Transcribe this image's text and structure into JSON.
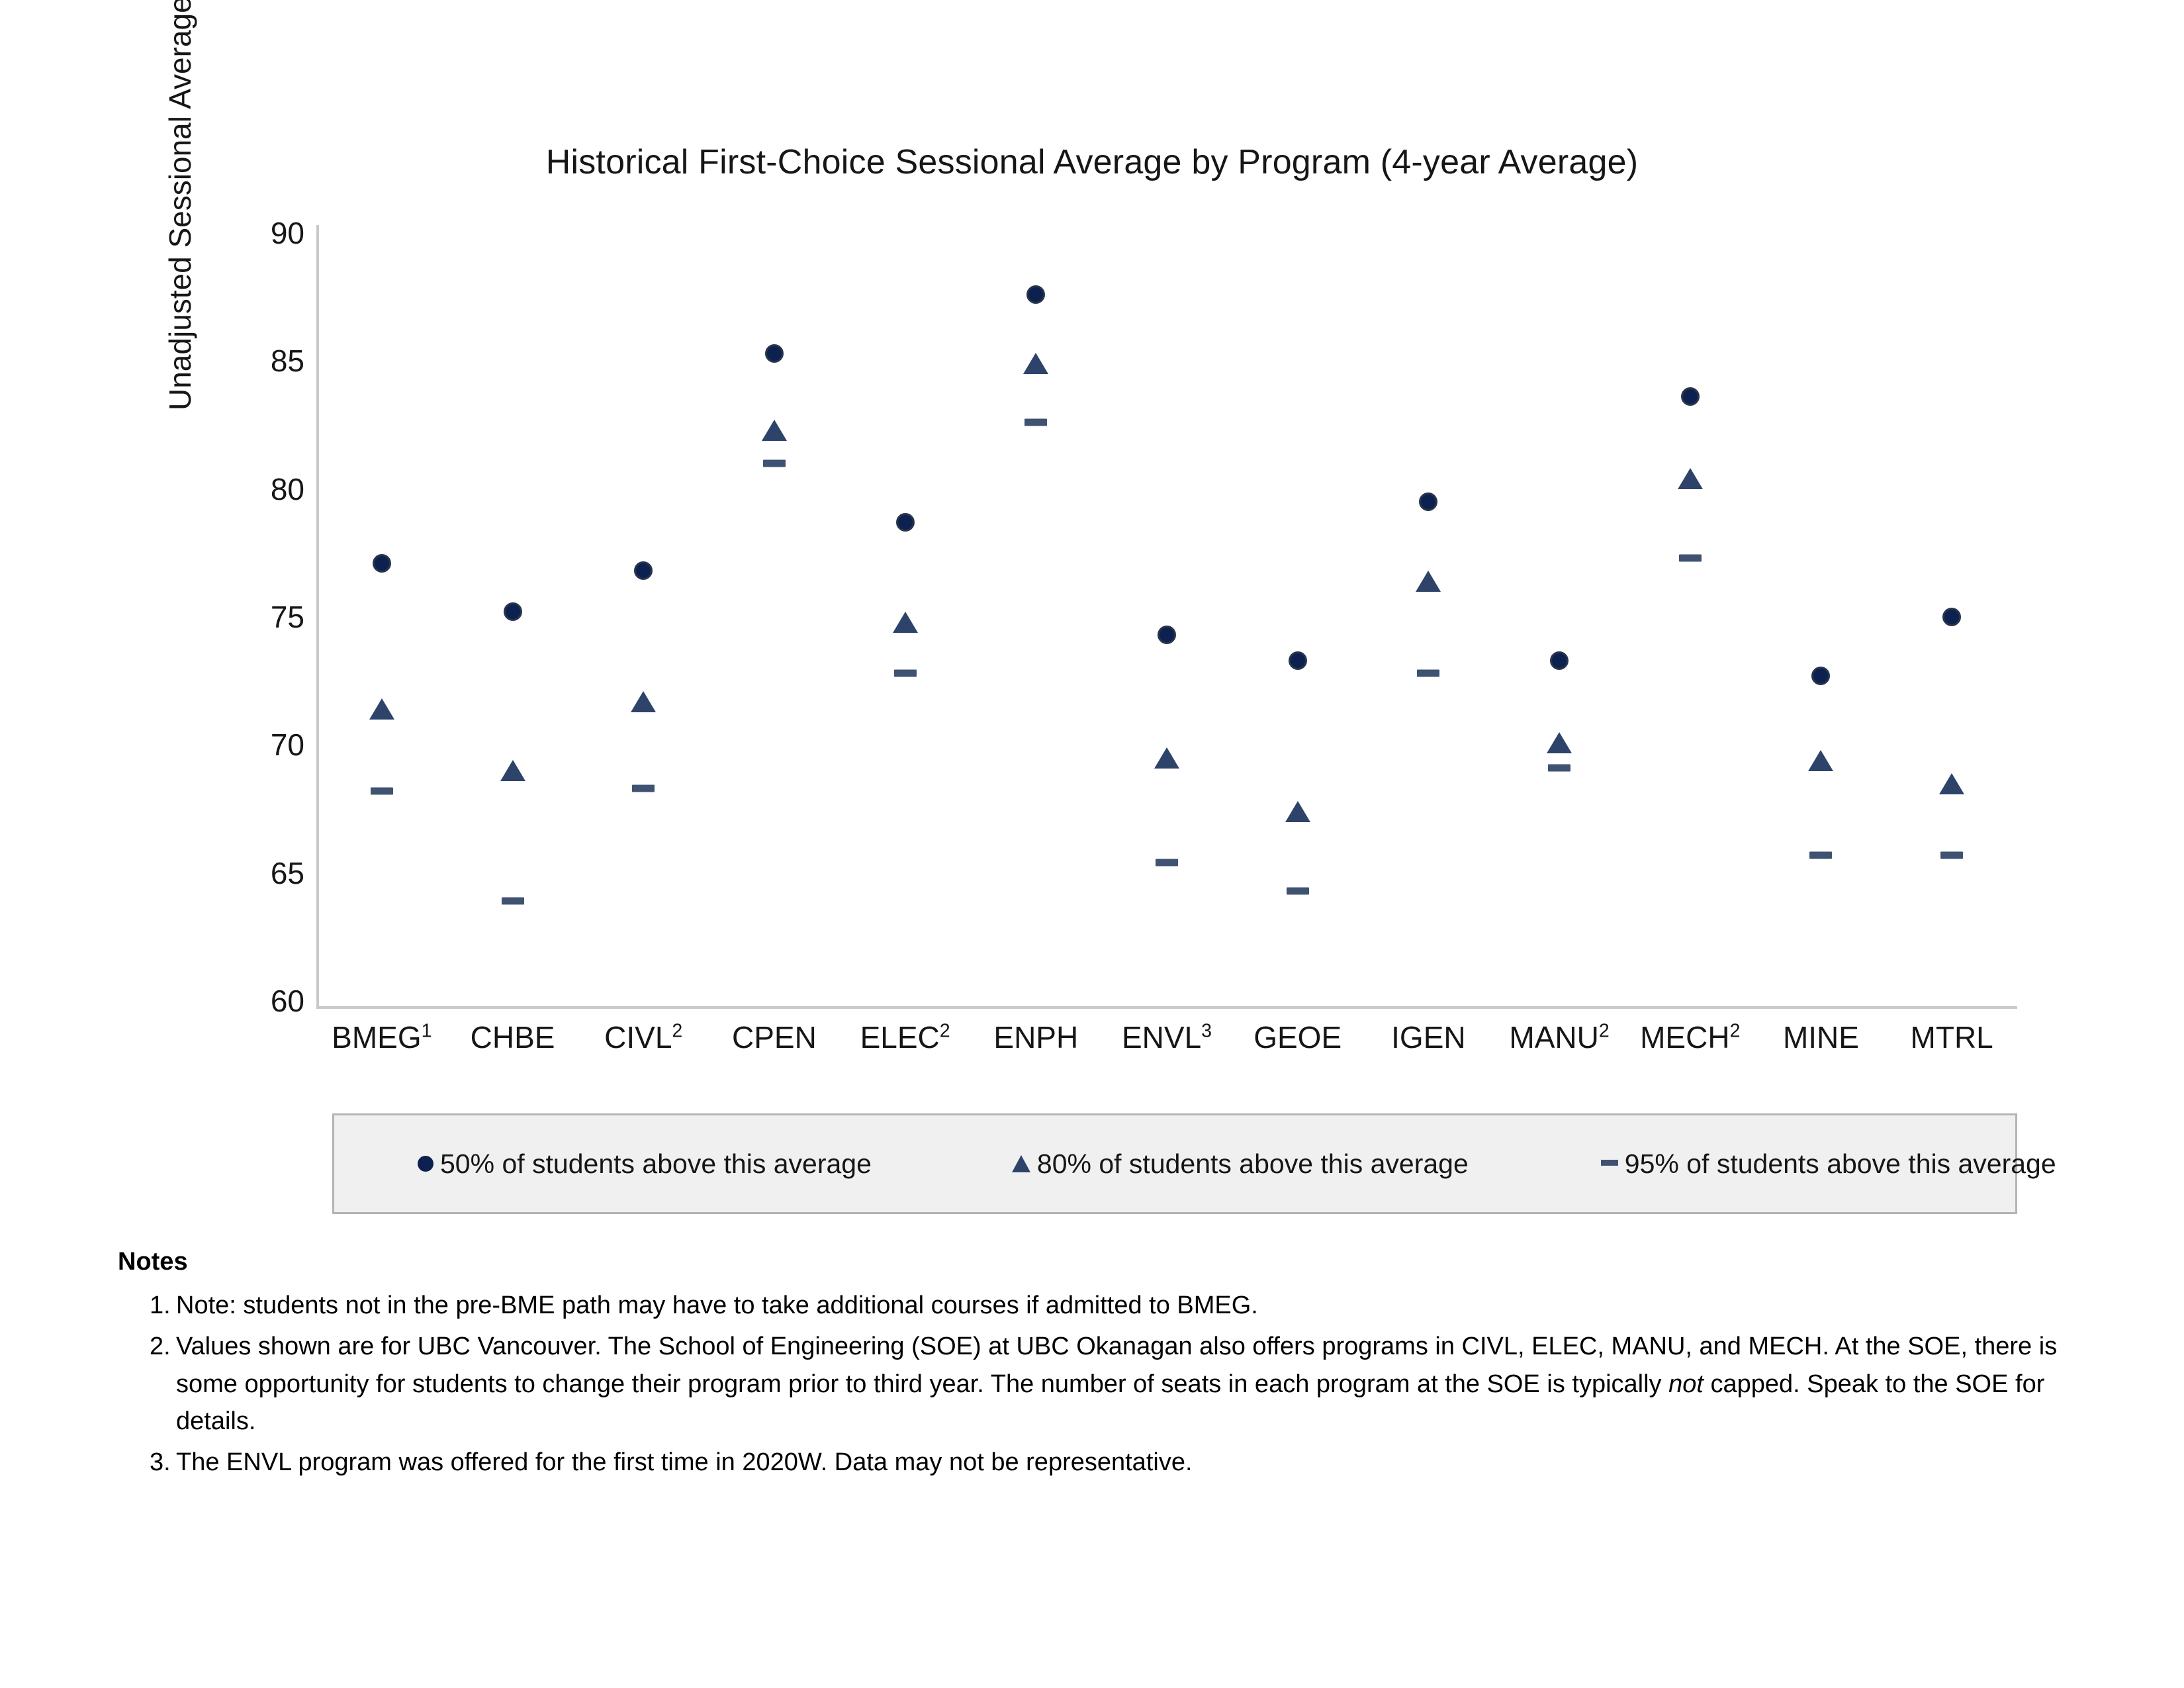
{
  "chart_data": {
    "type": "scatter",
    "title": "Historical First-Choice Sessional Average by Program (4-year Average)",
    "xlabel": "",
    "ylabel": "Unadjusted Sessional Average",
    "ylim": [
      60,
      90
    ],
    "ytick_labels": [
      "90",
      "85",
      "80",
      "75",
      "70",
      "65",
      "60"
    ],
    "yticks": [
      90,
      85,
      80,
      75,
      70,
      65,
      60
    ],
    "grid": false,
    "legend_position": "bottom",
    "categories": [
      "BMEG",
      "CHBE",
      "CIVL",
      "CPEN",
      "ELEC",
      "ENPH",
      "ENVL",
      "GEOE",
      "IGEN",
      "MANU",
      "MECH",
      "MINE",
      "MTRL"
    ],
    "category_footnotes": [
      "1",
      "",
      "2",
      "",
      "2",
      "",
      "3",
      "",
      "",
      "2",
      "2",
      "",
      ""
    ],
    "category_labels": [
      "BMEG1",
      "CHBE",
      "CIVL2",
      "CPEN",
      "ELEC2",
      "ENPH",
      "ENVL3",
      "GEOE",
      "IGEN",
      "MANU2",
      "MECH2",
      "MINE",
      "MTRL"
    ],
    "series": [
      {
        "name": "50% of students above this average",
        "marker": "circle",
        "color": "#0d2150",
        "values": [
          77.1,
          75.2,
          76.8,
          85.3,
          78.7,
          87.6,
          74.3,
          73.3,
          79.5,
          73.3,
          83.6,
          72.7,
          75.0
        ]
      },
      {
        "name": "80% of students above this average",
        "marker": "triangle",
        "color": "#2e4369",
        "values": [
          71.6,
          69.2,
          71.9,
          82.5,
          75.0,
          85.1,
          69.7,
          67.6,
          76.6,
          70.3,
          80.6,
          69.6,
          68.7
        ]
      },
      {
        "name": "95% of students above this average",
        "marker": "dash",
        "color": "#3f5271",
        "values": [
          68.2,
          63.9,
          68.3,
          81.0,
          72.8,
          82.6,
          65.4,
          64.3,
          72.8,
          69.1,
          77.3,
          65.7,
          65.7
        ]
      }
    ]
  },
  "notes": {
    "heading": "Notes",
    "items": [
      {
        "number": "1.",
        "text": "Note: students not in the pre-BME path may have to take additional courses if admitted to BMEG.",
        "italic_word": ""
      },
      {
        "number": "2.",
        "text_part1": "Values shown are for UBC Vancouver.  The School of Engineering (SOE) at UBC Okanagan also offers programs in CIVL, ELEC, MANU, and MECH.  At the SOE, there is some opportunity for students to change their program prior to third year.  The number of seats in each program at the SOE is typically ",
        "italic_word": "not",
        "text_part2": " capped.  Speak to the SOE for details."
      },
      {
        "number": "3.",
        "text": "The ENVL program was offered for the first time in 2020W.  Data may not be representative.",
        "italic_word": ""
      }
    ]
  },
  "colors": {
    "series_50": "#0d2150",
    "series_80": "#2e4369",
    "series_95": "#3f5271",
    "axis": "#c9c9c9",
    "legend_background": "#f0f0f0",
    "legend_border": "#b4b4b4"
  }
}
